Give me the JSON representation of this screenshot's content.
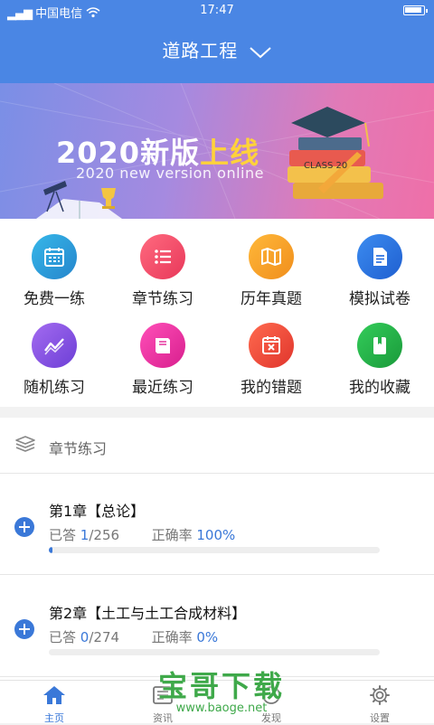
{
  "status_bar": {
    "carrier": "中国电信",
    "time": "17:47"
  },
  "header": {
    "title": "道路工程"
  },
  "banner": {
    "title_part1": "2020新版",
    "title_part2": "上线",
    "subtitle": "2020 new version online",
    "book_label": "CLASS 20"
  },
  "grid": {
    "items": [
      {
        "label": "免费一练",
        "icon": "calendar-icon",
        "color": "#2f9fd6"
      },
      {
        "label": "章节练习",
        "icon": "list-icon",
        "color": "#f2536c"
      },
      {
        "label": "历年真题",
        "icon": "map-icon",
        "color": "#f5a623"
      },
      {
        "label": "模拟试卷",
        "icon": "document-icon",
        "color": "#2f74e0"
      },
      {
        "label": "随机练习",
        "icon": "trend-icon",
        "color": "#8a4fe0"
      },
      {
        "label": "最近练习",
        "icon": "book-icon",
        "color": "#e6339e"
      },
      {
        "label": "我的错题",
        "icon": "wrong-calendar-icon",
        "color": "#ee4d3c"
      },
      {
        "label": "我的收藏",
        "icon": "bookmark-icon",
        "color": "#27b14a"
      }
    ]
  },
  "section": {
    "title": "章节练习",
    "chapters": [
      {
        "title": "第1章【总论】",
        "answered_label": "已答",
        "answered": "1",
        "total": "/256",
        "accuracy_label": "正确率",
        "accuracy": "100%",
        "progress": 0.004
      },
      {
        "title": "第2章【土工与土工合成材料】",
        "answered_label": "已答",
        "answered": "0",
        "total": "/274",
        "accuracy_label": "正确率",
        "accuracy": "0%",
        "progress": 0
      }
    ]
  },
  "tabbar": {
    "tabs": [
      {
        "label": "主页",
        "icon": "home-icon",
        "active": true
      },
      {
        "label": "资讯",
        "icon": "news-icon",
        "active": false
      },
      {
        "label": "发现",
        "icon": "discover-icon",
        "active": false
      },
      {
        "label": "设置",
        "icon": "gear-icon",
        "active": false
      }
    ]
  },
  "watermark": {
    "name": "宝哥下载",
    "url": "www.baoge.net"
  },
  "colors": {
    "header_bg": "#4a86e4",
    "accent": "#3a78d8"
  }
}
